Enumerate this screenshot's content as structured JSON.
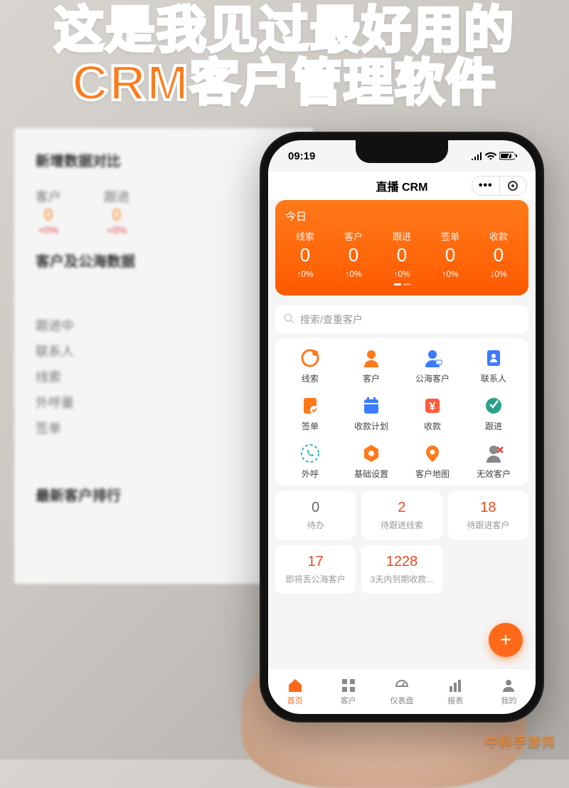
{
  "headline": "这是我见过最好用的\nCRM客户管理软件",
  "desktop": {
    "section1_title": "新增数据对比",
    "stats": [
      {
        "label": "客户",
        "val": "0",
        "pct": "+0%"
      },
      {
        "label": "跟进",
        "val": "0",
        "pct": "+0%"
      }
    ],
    "section2_title": "客户及公海数据",
    "list": [
      "跟进中",
      "联系人",
      "线索",
      "外呼量",
      "签单"
    ],
    "section3_title": "最新客户排行"
  },
  "statusbar": {
    "time": "09:19",
    "battery": "75"
  },
  "titlebar": {
    "title": "直播 CRM"
  },
  "today": {
    "header": "今日",
    "stats": [
      {
        "label": "线索",
        "value": "0",
        "pct": "↑0%"
      },
      {
        "label": "客户",
        "value": "0",
        "pct": "↑0%"
      },
      {
        "label": "跟进",
        "value": "0",
        "pct": "↑0%"
      },
      {
        "label": "签单",
        "value": "0",
        "pct": "↑0%"
      },
      {
        "label": "收款",
        "value": "0",
        "pct": "↓0%"
      }
    ]
  },
  "search": {
    "placeholder": "搜索/查重客户"
  },
  "grid": [
    {
      "name": "线索",
      "icon": "lead",
      "color": "#ff7a1a"
    },
    {
      "name": "客户",
      "icon": "customer",
      "color": "#ff7a1a"
    },
    {
      "name": "公海客户",
      "icon": "sea",
      "color": "#3b7bff"
    },
    {
      "name": "联系人",
      "icon": "contact",
      "color": "#3b7bff"
    },
    {
      "name": "签单",
      "icon": "contract",
      "color": "#ff7a1a"
    },
    {
      "name": "收款计划",
      "icon": "plan",
      "color": "#3b7bff"
    },
    {
      "name": "收款",
      "icon": "payment",
      "color": "#ff5a3a"
    },
    {
      "name": "跟进",
      "icon": "follow",
      "color": "#2aa08a"
    },
    {
      "name": "外呼",
      "icon": "call",
      "color": "#3bb0c0"
    },
    {
      "name": "基础设置",
      "icon": "settings",
      "color": "#ff7a1a"
    },
    {
      "name": "客户地图",
      "icon": "map",
      "color": "#ff7a1a"
    },
    {
      "name": "无效客户",
      "icon": "invalid",
      "color": "#888"
    }
  ],
  "tiles": [
    {
      "n": "0",
      "t": "待办",
      "red": false
    },
    {
      "n": "2",
      "t": "待跟进线索",
      "red": true
    },
    {
      "n": "18",
      "t": "待跟进客户",
      "red": true
    },
    {
      "n": "17",
      "t": "即将丢公海客户",
      "red": true
    },
    {
      "n": "1228",
      "t": "3天内到期收款...",
      "red": true
    }
  ],
  "tabs": [
    {
      "label": "首页",
      "icon": "home",
      "active": true
    },
    {
      "label": "客户",
      "icon": "grid",
      "active": false
    },
    {
      "label": "仪表盘",
      "icon": "dash",
      "active": false
    },
    {
      "label": "报表",
      "icon": "report",
      "active": false
    },
    {
      "label": "我的",
      "icon": "me",
      "active": false
    }
  ],
  "watermark": "中科手游网"
}
